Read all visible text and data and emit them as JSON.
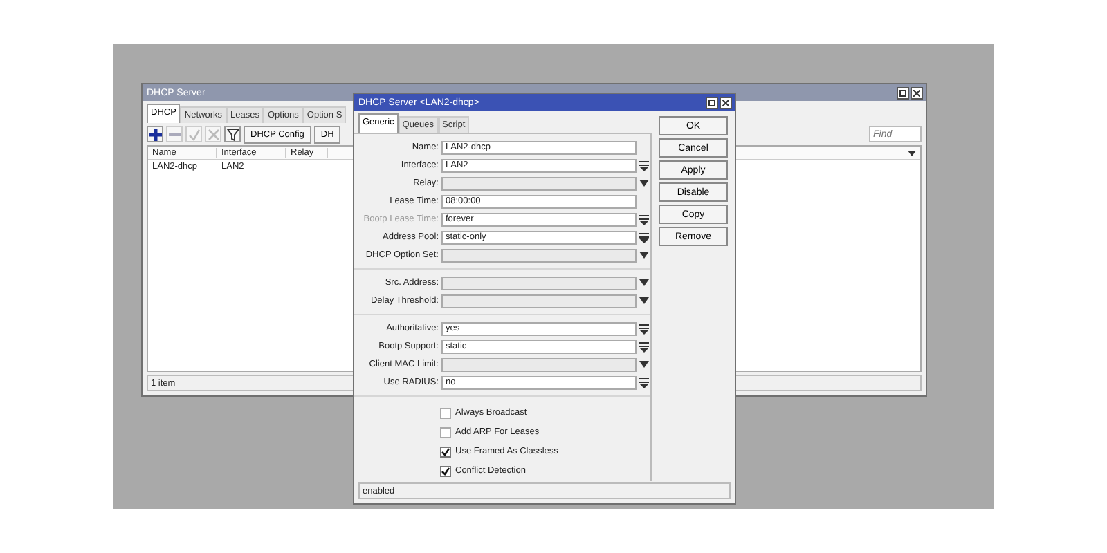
{
  "main_window": {
    "title": "DHCP Server",
    "tabs": [
      {
        "label": "DHCP",
        "selected": true
      },
      {
        "label": "Networks",
        "selected": false
      },
      {
        "label": "Leases",
        "selected": false
      },
      {
        "label": "Options",
        "selected": false
      },
      {
        "label": "Option S",
        "selected": false
      }
    ],
    "toolbar_buttons": [
      "DHCP Config",
      "DH"
    ],
    "find": {
      "placeholder": "Find"
    },
    "columns": [
      "Name",
      "Interface",
      "Relay"
    ],
    "rows": [
      {
        "name": "LAN2-dhcp",
        "interface": "LAN2"
      }
    ],
    "status_bar": "1 item"
  },
  "dialog": {
    "title": "DHCP Server <LAN2-dhcp>",
    "tabs": [
      {
        "label": "Generic",
        "selected": true
      },
      {
        "label": "Queues",
        "selected": false
      },
      {
        "label": "Script",
        "selected": false
      }
    ],
    "field_groups": [
      [
        {
          "label": "Name:",
          "kind": "text",
          "value": "LAN2-dhcp",
          "disabled": false
        },
        {
          "label": "Interface:",
          "kind": "select",
          "value": "LAN2",
          "disabled": false
        },
        {
          "label": "Relay:",
          "kind": "combo",
          "disabled": false
        },
        {
          "label": "Lease Time:",
          "kind": "text",
          "value": "08:00:00",
          "disabled": false
        },
        {
          "label": "Bootp Lease Time:",
          "kind": "select",
          "value": "forever",
          "disabled": true
        },
        {
          "label": "Address Pool:",
          "kind": "select",
          "value": "static-only",
          "disabled": false
        },
        {
          "label": "DHCP Option Set:",
          "kind": "combo",
          "disabled": false
        }
      ],
      [
        {
          "label": "Src. Address:",
          "kind": "combo",
          "disabled": false
        },
        {
          "label": "Delay Threshold:",
          "kind": "combo",
          "disabled": false
        }
      ],
      [
        {
          "label": "Authoritative:",
          "kind": "select",
          "value": "yes",
          "disabled": false
        },
        {
          "label": "Bootp Support:",
          "kind": "select",
          "value": "static",
          "disabled": false
        },
        {
          "label": "Client MAC Limit:",
          "kind": "combo",
          "disabled": false
        },
        {
          "label": "Use RADIUS:",
          "kind": "select",
          "value": "no",
          "disabled": false
        }
      ]
    ],
    "checkboxes": [
      {
        "label": "Always Broadcast",
        "checked": false
      },
      {
        "label": "Add ARP For Leases",
        "checked": false
      },
      {
        "label": "Use Framed As Classless",
        "checked": true
      },
      {
        "label": "Conflict Detection",
        "checked": true
      }
    ],
    "buttons": [
      "OK",
      "Cancel",
      "Apply",
      "Disable",
      "Copy",
      "Remove"
    ],
    "status_bar": "enabled"
  }
}
